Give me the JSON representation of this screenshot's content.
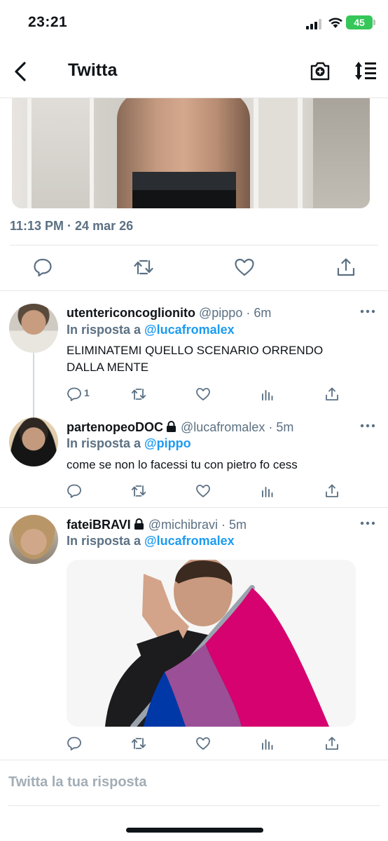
{
  "status": {
    "time": "23:21",
    "battery": "45"
  },
  "nav": {
    "title": "Twitta"
  },
  "main_tweet": {
    "timestamp": "11:13 PM · 24 mar 26"
  },
  "replies": [
    {
      "display_name": "utentericoncoglionito",
      "handle": "@pippo",
      "age": "· 6m",
      "reply_prefix": "In risposta a",
      "reply_to": "@lucafromalex",
      "text_lines": [
        "ELIMINATEMI QUELLO SCENARIO ORRENDO",
        "DALLA MENTE"
      ],
      "reply_count": "1",
      "locked": false
    },
    {
      "display_name": "partenopeoDOC",
      "handle": "@lucafromalex",
      "age": "· 5m",
      "reply_prefix": "In risposta a",
      "reply_to": "@pippo",
      "text_lines": [
        "come se non lo facessi tu con pietro fo cess"
      ],
      "locked": true
    },
    {
      "display_name": "fateiBRAVI",
      "handle": "@michibravi",
      "age": "· 5m",
      "reply_prefix": "In risposta a",
      "reply_to": "@lucafromalex",
      "text_lines": [],
      "locked": true
    }
  ],
  "composer": {
    "placeholder": "Twitta la tua risposta"
  },
  "icons": {
    "back": "chevron-left-icon",
    "camera": "camera-plus-icon",
    "sort": "sort-icon",
    "reply": "reply-icon",
    "retweet": "retweet-icon",
    "like": "heart-icon",
    "share": "share-icon",
    "analytics": "analytics-icon",
    "more": "more-icon",
    "lock": "lock-icon"
  },
  "colors": {
    "accent": "#1d9bf0",
    "muted": "#5b7083",
    "battery": "#35c759"
  }
}
